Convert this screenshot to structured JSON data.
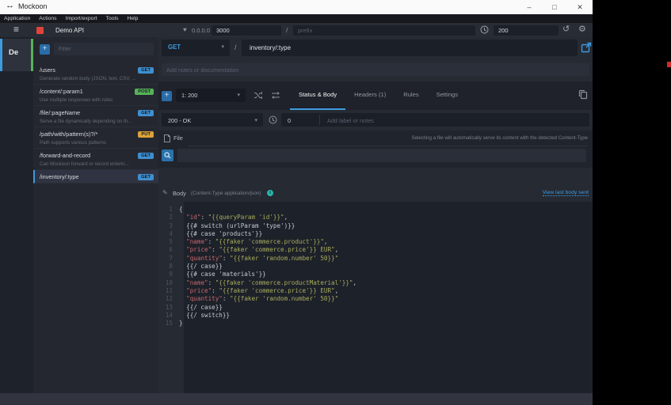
{
  "window": {
    "title": "Mockoon",
    "controls": {
      "minimize": "–",
      "maximize": "□",
      "close": "✕"
    }
  },
  "icons": {
    "logo": "↔",
    "hamburger": "≡",
    "server": "♥",
    "history": "↺",
    "gear": "⚙",
    "caret": "▾",
    "plus": "+",
    "pencil": "✎",
    "info": "i"
  },
  "menu": {
    "items": [
      "Application",
      "Actions",
      "Import/export",
      "Tools",
      "Help"
    ]
  },
  "toolbar": {
    "env_name": "Demo API",
    "address": "0.0.0.0 :",
    "port": "3000",
    "path_sep": "/",
    "prefix_placeholder": "prefix",
    "latency": "200"
  },
  "env_column": {
    "label": "De"
  },
  "sidebar": {
    "filter_placeholder": "Filter",
    "routes": [
      {
        "path": "/users",
        "method": "GET",
        "desc": "Generate random body (JSON, text, CSV, ...",
        "selected": false
      },
      {
        "path": "/content/:param1",
        "method": "POST",
        "desc": "Use multiple responses with rules",
        "selected": false
      },
      {
        "path": "/file/:pageName",
        "method": "GET",
        "desc": "Serve a file dynamically depending on th...",
        "selected": false
      },
      {
        "path": "/path/with/pattern(s)?/*",
        "method": "PUT",
        "desc": "Path supports various patterns",
        "selected": false
      },
      {
        "path": "/forward-and-record",
        "method": "GET",
        "desc": "Can Mockoon forward or record enterin...",
        "selected": false
      },
      {
        "path": "/inventory/:type",
        "method": "GET",
        "desc": "",
        "selected": true
      }
    ]
  },
  "route_header": {
    "method": "GET",
    "separator": "/",
    "path": "inventory/:type"
  },
  "notes": {
    "placeholder": "Add notes or documentation"
  },
  "response_bar": {
    "selected": "1: 200",
    "tabs": [
      {
        "label": "Status & Body",
        "active": true
      },
      {
        "label": "Headers (1)",
        "active": false
      },
      {
        "label": "Rules",
        "active": false
      },
      {
        "label": "Settings",
        "active": false
      }
    ]
  },
  "status_row": {
    "status": "200 - OK",
    "latency": "0",
    "label_placeholder": "Add label or notes"
  },
  "file_section": {
    "label": "File",
    "hint": "Selecting a file will automatically serve its content with the detected Content-Type"
  },
  "body_section": {
    "label": "Body",
    "content_type": "(Content-Type application/json)",
    "link": "View last body sent"
  },
  "editor": {
    "lines": [
      {
        "num": "1",
        "tokens": [
          {
            "text": "{",
            "type": "plain"
          }
        ]
      },
      {
        "num": "2",
        "tokens": [
          {
            "text": "  ",
            "type": "plain"
          },
          {
            "text": "\"id\"",
            "type": "key"
          },
          {
            "text": ": ",
            "type": "plain"
          },
          {
            "text": "\"{{queryParam 'id'}}\"",
            "type": "str"
          },
          {
            "text": ",",
            "type": "plain"
          }
        ]
      },
      {
        "num": "3",
        "tokens": [
          {
            "text": "  {{# switch (urlParam 'type')}}",
            "type": "plain"
          }
        ]
      },
      {
        "num": "4",
        "tokens": [
          {
            "text": "  {{# case 'products'}}",
            "type": "plain"
          }
        ]
      },
      {
        "num": "5",
        "tokens": [
          {
            "text": "  ",
            "type": "plain"
          },
          {
            "text": "\"name\"",
            "type": "key"
          },
          {
            "text": ": ",
            "type": "plain"
          },
          {
            "text": "\"{{faker 'commerce.product'}}\"",
            "type": "str"
          },
          {
            "text": ",",
            "type": "plain"
          }
        ]
      },
      {
        "num": "6",
        "tokens": [
          {
            "text": "  ",
            "type": "plain"
          },
          {
            "text": "\"price\"",
            "type": "key"
          },
          {
            "text": ": ",
            "type": "plain"
          },
          {
            "text": "\"{{faker 'commerce.price'}} EUR\"",
            "type": "str"
          },
          {
            "text": ",",
            "type": "plain"
          }
        ]
      },
      {
        "num": "7",
        "tokens": [
          {
            "text": "  ",
            "type": "plain"
          },
          {
            "text": "\"quantity\"",
            "type": "key"
          },
          {
            "text": ": ",
            "type": "plain"
          },
          {
            "text": "\"{{faker 'random.number' 50}}\"",
            "type": "str"
          }
        ]
      },
      {
        "num": "8",
        "tokens": [
          {
            "text": "  {{/ case}}",
            "type": "plain"
          }
        ]
      },
      {
        "num": "9",
        "tokens": [
          {
            "text": "  {{# case 'materials'}}",
            "type": "plain"
          }
        ]
      },
      {
        "num": "10",
        "tokens": [
          {
            "text": "  ",
            "type": "plain"
          },
          {
            "text": "\"name\"",
            "type": "key"
          },
          {
            "text": ": ",
            "type": "plain"
          },
          {
            "text": "\"{{faker 'commerce.productMaterial'}}\"",
            "type": "str"
          },
          {
            "text": ",",
            "type": "plain"
          }
        ]
      },
      {
        "num": "11",
        "tokens": [
          {
            "text": "  ",
            "type": "plain"
          },
          {
            "text": "\"price\"",
            "type": "key"
          },
          {
            "text": ": ",
            "type": "plain"
          },
          {
            "text": "\"{{faker 'commerce.price'}} EUR\"",
            "type": "str"
          },
          {
            "text": ",",
            "type": "plain"
          }
        ]
      },
      {
        "num": "12",
        "tokens": [
          {
            "text": "  ",
            "type": "plain"
          },
          {
            "text": "\"quantity\"",
            "type": "key"
          },
          {
            "text": ": ",
            "type": "plain"
          },
          {
            "text": "\"{{faker 'random.number' 50}}\"",
            "type": "str"
          }
        ]
      },
      {
        "num": "13",
        "tokens": [
          {
            "text": "  {{/ case}}",
            "type": "plain"
          }
        ]
      },
      {
        "num": "14",
        "tokens": [
          {
            "text": "  {{/ switch}}",
            "type": "plain"
          }
        ]
      },
      {
        "num": "15",
        "tokens": [
          {
            "text": "}",
            "type": "plain"
          }
        ]
      }
    ]
  },
  "colors": {
    "accent": "#3d9be0",
    "get": "#3f8fd0",
    "post": "#57b158",
    "put": "#dba239",
    "running": "#e0433c"
  }
}
